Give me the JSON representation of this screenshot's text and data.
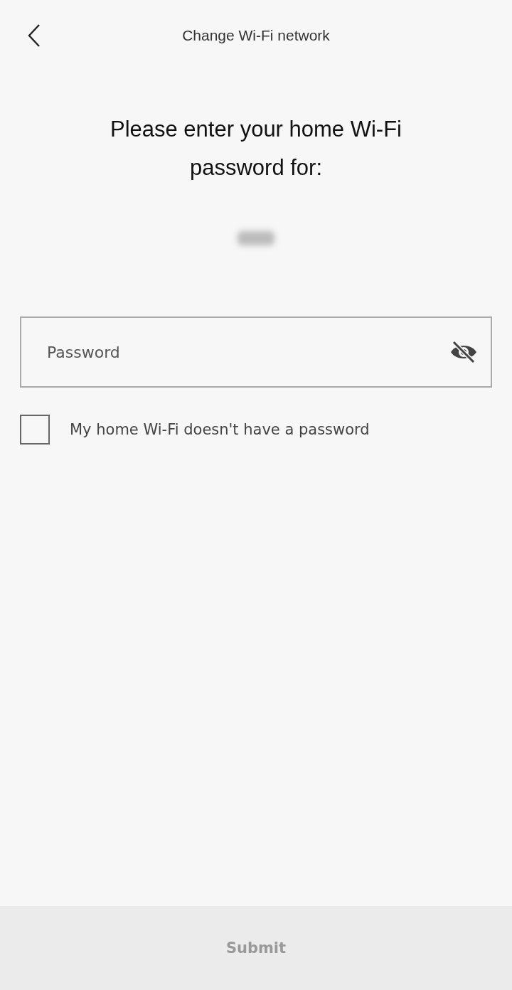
{
  "header": {
    "title": "Change Wi-Fi network"
  },
  "heading": "Please enter your home Wi-Fi password for:",
  "network_name": {
    "kind": "blurred"
  },
  "password_field": {
    "placeholder": "Password",
    "reveal": false
  },
  "no_password_option": {
    "label": "My home Wi-Fi doesn't have a password",
    "checked": false
  },
  "submit_button": {
    "label": "Submit",
    "disabled": true
  }
}
